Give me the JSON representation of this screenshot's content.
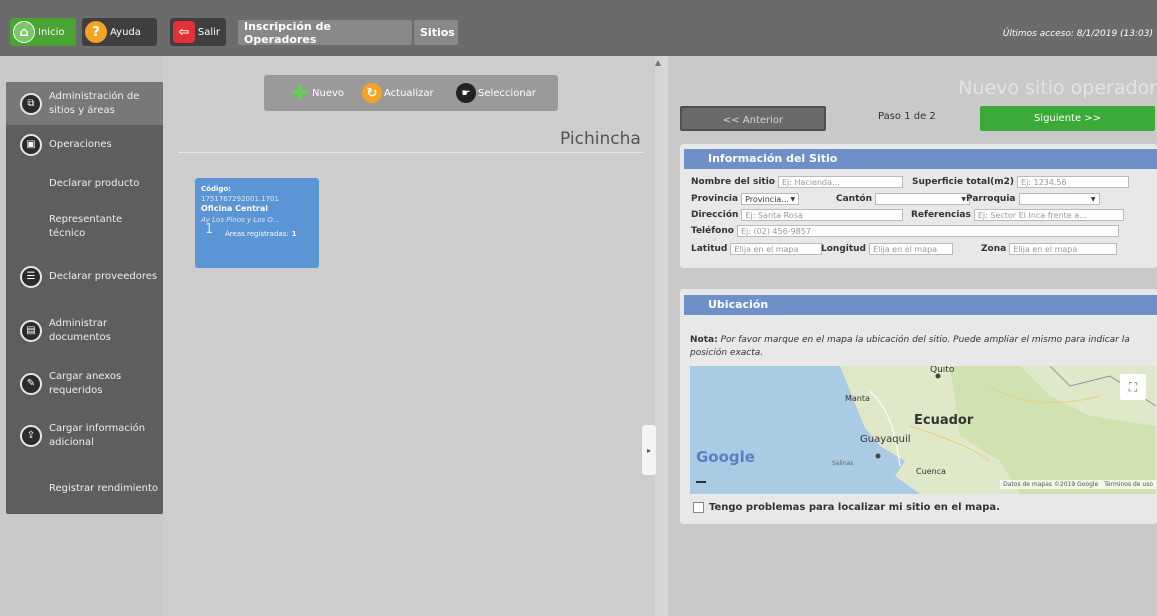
{
  "topbar": {
    "inicio": "Inicio",
    "ayuda": "Ayuda",
    "salir": "Salir",
    "nav_inscripcion": "Inscripción de Operadores",
    "nav_sitios": "Sitios",
    "last_access": "Últimos acceso: 8/1/2019 (13:03)"
  },
  "sidebar": {
    "items": [
      {
        "label": "Administración de sitios y áreas",
        "icon": "sitemap-icon"
      },
      {
        "label": "Operaciones",
        "icon": "operations-icon"
      },
      {
        "label": "Declarar producto"
      },
      {
        "label": "Representante técnico"
      },
      {
        "label": "Declarar proveedores",
        "icon": "providers-icon"
      },
      {
        "label": "Administrar documentos",
        "icon": "documents-icon"
      },
      {
        "label": "Cargar anexos requeridos",
        "icon": "attachment-icon"
      },
      {
        "label": "Cargar información adicional",
        "icon": "upload-icon"
      },
      {
        "label": "Registrar rendimiento"
      }
    ]
  },
  "toolbar": {
    "nuevo": "Nuevo",
    "actualizar": "Actualizar",
    "seleccionar": "Seleccionar"
  },
  "province_title": "Pichincha",
  "site_card": {
    "code_label": "Código:",
    "code": "1751767292001.1701",
    "name": "Oficina Central",
    "address": "Av Los Pinos y Los O...",
    "count": "1",
    "areas_label": "Áreas registradas:",
    "areas_value": "1"
  },
  "wizard": {
    "title": "Nuevo sitio operador",
    "prev": "<< Anterior",
    "step": "Paso 1 de 2",
    "next": "Siguiente >>"
  },
  "info_section": {
    "header": "Información del Sitio",
    "nombre_label": "Nombre del sitio",
    "nombre_ph": "Ej: Hacienda...",
    "superficie_label": "Superficie total(m2)",
    "superficie_ph": "Ej: 1234.56",
    "provincia_label": "Provincia",
    "provincia_value": "Provincia...",
    "canton_label": "Cantón",
    "canton_value": "",
    "parroquia_label": "Parroquia",
    "parroquia_value": "",
    "direccion_label": "Dirección",
    "direccion_ph": "Ej: Santa Rosa",
    "referencias_label": "Referencias",
    "referencias_ph": "Ej: Sector El Inca frente a...",
    "telefono_label": "Teléfono",
    "telefono_ph": "Ej: (02) 456-9857",
    "latitud_label": "Latitud",
    "latitud_ph": "Elija en el mapa",
    "longitud_label": "Longitud",
    "longitud_ph": "Elija en el mapa",
    "zona_label": "Zona",
    "zona_ph": "Elija en el mapa"
  },
  "location_section": {
    "header": "Ubicación",
    "note_label": "Nota:",
    "note_text": "Por favor marque en el mapa la ubicación del sitio. Puede ampliar el mismo para indicar la posición exacta.",
    "map": {
      "quito": "Quito",
      "manta": "Manta",
      "ecuador": "Ecuador",
      "guayaquil": "Guayaquil",
      "salinas": "Salinas",
      "cuenca": "Cuenca",
      "google": "Google",
      "attribution": "Datos de mapas ©2019 Google",
      "terms": "Términos de uso"
    },
    "checkbox_label": "Tengo problemas para localizar mi sitio en el mapa."
  }
}
